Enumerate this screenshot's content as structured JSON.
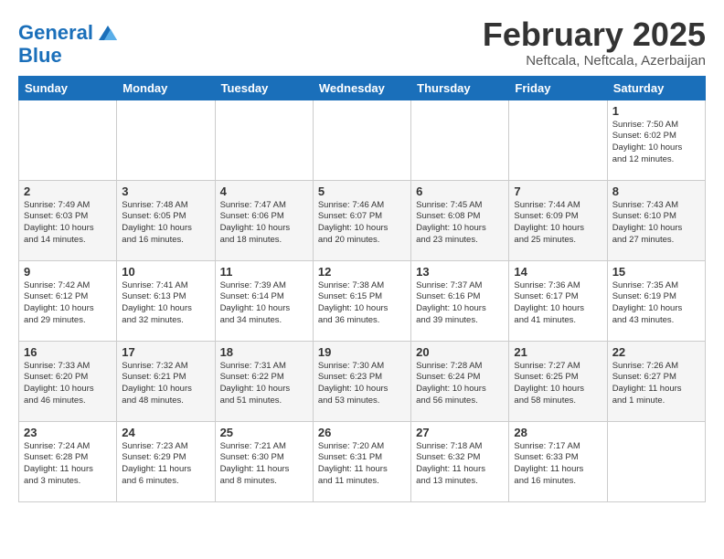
{
  "header": {
    "logo_general": "General",
    "logo_blue": "Blue",
    "month_title": "February 2025",
    "location": "Neftcala, Neftcala, Azerbaijan"
  },
  "days_of_week": [
    "Sunday",
    "Monday",
    "Tuesday",
    "Wednesday",
    "Thursday",
    "Friday",
    "Saturday"
  ],
  "weeks": [
    [
      {
        "day": "",
        "info": ""
      },
      {
        "day": "",
        "info": ""
      },
      {
        "day": "",
        "info": ""
      },
      {
        "day": "",
        "info": ""
      },
      {
        "day": "",
        "info": ""
      },
      {
        "day": "",
        "info": ""
      },
      {
        "day": "1",
        "info": "Sunrise: 7:50 AM\nSunset: 6:02 PM\nDaylight: 10 hours\nand 12 minutes."
      }
    ],
    [
      {
        "day": "2",
        "info": "Sunrise: 7:49 AM\nSunset: 6:03 PM\nDaylight: 10 hours\nand 14 minutes."
      },
      {
        "day": "3",
        "info": "Sunrise: 7:48 AM\nSunset: 6:05 PM\nDaylight: 10 hours\nand 16 minutes."
      },
      {
        "day": "4",
        "info": "Sunrise: 7:47 AM\nSunset: 6:06 PM\nDaylight: 10 hours\nand 18 minutes."
      },
      {
        "day": "5",
        "info": "Sunrise: 7:46 AM\nSunset: 6:07 PM\nDaylight: 10 hours\nand 20 minutes."
      },
      {
        "day": "6",
        "info": "Sunrise: 7:45 AM\nSunset: 6:08 PM\nDaylight: 10 hours\nand 23 minutes."
      },
      {
        "day": "7",
        "info": "Sunrise: 7:44 AM\nSunset: 6:09 PM\nDaylight: 10 hours\nand 25 minutes."
      },
      {
        "day": "8",
        "info": "Sunrise: 7:43 AM\nSunset: 6:10 PM\nDaylight: 10 hours\nand 27 minutes."
      }
    ],
    [
      {
        "day": "9",
        "info": "Sunrise: 7:42 AM\nSunset: 6:12 PM\nDaylight: 10 hours\nand 29 minutes."
      },
      {
        "day": "10",
        "info": "Sunrise: 7:41 AM\nSunset: 6:13 PM\nDaylight: 10 hours\nand 32 minutes."
      },
      {
        "day": "11",
        "info": "Sunrise: 7:39 AM\nSunset: 6:14 PM\nDaylight: 10 hours\nand 34 minutes."
      },
      {
        "day": "12",
        "info": "Sunrise: 7:38 AM\nSunset: 6:15 PM\nDaylight: 10 hours\nand 36 minutes."
      },
      {
        "day": "13",
        "info": "Sunrise: 7:37 AM\nSunset: 6:16 PM\nDaylight: 10 hours\nand 39 minutes."
      },
      {
        "day": "14",
        "info": "Sunrise: 7:36 AM\nSunset: 6:17 PM\nDaylight: 10 hours\nand 41 minutes."
      },
      {
        "day": "15",
        "info": "Sunrise: 7:35 AM\nSunset: 6:19 PM\nDaylight: 10 hours\nand 43 minutes."
      }
    ],
    [
      {
        "day": "16",
        "info": "Sunrise: 7:33 AM\nSunset: 6:20 PM\nDaylight: 10 hours\nand 46 minutes."
      },
      {
        "day": "17",
        "info": "Sunrise: 7:32 AM\nSunset: 6:21 PM\nDaylight: 10 hours\nand 48 minutes."
      },
      {
        "day": "18",
        "info": "Sunrise: 7:31 AM\nSunset: 6:22 PM\nDaylight: 10 hours\nand 51 minutes."
      },
      {
        "day": "19",
        "info": "Sunrise: 7:30 AM\nSunset: 6:23 PM\nDaylight: 10 hours\nand 53 minutes."
      },
      {
        "day": "20",
        "info": "Sunrise: 7:28 AM\nSunset: 6:24 PM\nDaylight: 10 hours\nand 56 minutes."
      },
      {
        "day": "21",
        "info": "Sunrise: 7:27 AM\nSunset: 6:25 PM\nDaylight: 10 hours\nand 58 minutes."
      },
      {
        "day": "22",
        "info": "Sunrise: 7:26 AM\nSunset: 6:27 PM\nDaylight: 11 hours\nand 1 minute."
      }
    ],
    [
      {
        "day": "23",
        "info": "Sunrise: 7:24 AM\nSunset: 6:28 PM\nDaylight: 11 hours\nand 3 minutes."
      },
      {
        "day": "24",
        "info": "Sunrise: 7:23 AM\nSunset: 6:29 PM\nDaylight: 11 hours\nand 6 minutes."
      },
      {
        "day": "25",
        "info": "Sunrise: 7:21 AM\nSunset: 6:30 PM\nDaylight: 11 hours\nand 8 minutes."
      },
      {
        "day": "26",
        "info": "Sunrise: 7:20 AM\nSunset: 6:31 PM\nDaylight: 11 hours\nand 11 minutes."
      },
      {
        "day": "27",
        "info": "Sunrise: 7:18 AM\nSunset: 6:32 PM\nDaylight: 11 hours\nand 13 minutes."
      },
      {
        "day": "28",
        "info": "Sunrise: 7:17 AM\nSunset: 6:33 PM\nDaylight: 11 hours\nand 16 minutes."
      },
      {
        "day": "",
        "info": ""
      }
    ]
  ]
}
